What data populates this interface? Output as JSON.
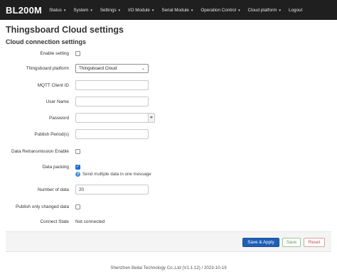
{
  "navbar": {
    "brand": "BL200M",
    "items": [
      {
        "label": "Status"
      },
      {
        "label": "System"
      },
      {
        "label": "Settings"
      },
      {
        "label": "I/O Module"
      },
      {
        "label": "Serial Module"
      },
      {
        "label": "Operation Control"
      },
      {
        "label": "Cloud platform"
      },
      {
        "label": "Logout"
      }
    ]
  },
  "page": {
    "title": "Thingsboard Cloud settings",
    "section_title": "Cloud connection settings"
  },
  "form": {
    "enable_setting": {
      "label": "Enable setting",
      "checked": false
    },
    "platform": {
      "label": "Thingsboard platform",
      "value": "Thingsboard Cloud"
    },
    "mqtt_client_id": {
      "label": "MQTT Client ID",
      "value": ""
    },
    "user_name": {
      "label": "User Name",
      "value": ""
    },
    "password": {
      "label": "Password",
      "value": ""
    },
    "publish_period": {
      "label": "Publish Period(s)",
      "value": ""
    },
    "data_retransmission": {
      "label": "Data Retransmission Enable",
      "checked": false
    },
    "data_packing": {
      "label": "Data packing",
      "checked": true,
      "hint": "Send multiple data in one message"
    },
    "number_of_data": {
      "label": "Number of data",
      "value": "20"
    },
    "publish_only_changed": {
      "label": "Publish only changed data",
      "checked": false
    },
    "connect_state": {
      "label": "Connect State",
      "value": "Not connected"
    }
  },
  "actions": {
    "save_apply": "Save & Apply",
    "save": "Save",
    "reset": "Reset"
  },
  "footer": {
    "copyright": "Shenzhen Beilai Technology Co.,Ltd (V1.1.12) / 2023-10-19"
  },
  "colors": {
    "navbar_bg": "#1f1f1f",
    "primary_button": "#1f5fb5",
    "save_button": "#5c9a5c",
    "reset_button": "#c04c4c"
  }
}
